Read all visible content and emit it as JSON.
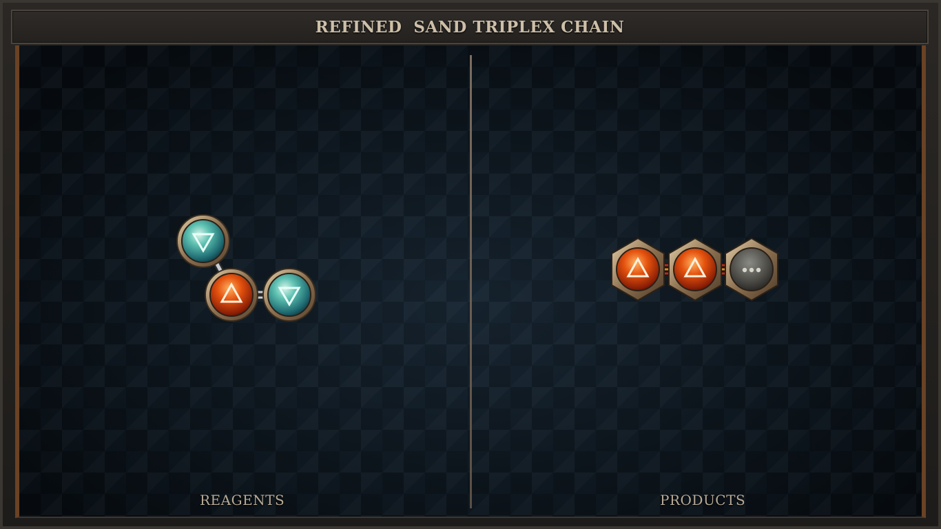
{
  "title": "REFINED  SAND TRIPLEX CHAIN",
  "reagents": {
    "label": "REAGENTS",
    "atoms": [
      {
        "element": "water",
        "symbol": "water-triangle-down-icon"
      },
      {
        "element": "fire",
        "symbol": "fire-triangle-up-icon"
      },
      {
        "element": "water",
        "symbol": "water-triangle-down-icon"
      }
    ]
  },
  "products": {
    "label": "PRODUCTS",
    "atoms": [
      {
        "element": "fire",
        "symbol": "fire-triangle-up-icon"
      },
      {
        "element": "fire",
        "symbol": "fire-triangle-up-icon"
      },
      {
        "element": "salt",
        "symbol": "salt-dots-icon"
      }
    ],
    "bond_type": "triplex"
  },
  "colors": {
    "water": "#43b0a8",
    "fire": "#d9480a",
    "salt": "#5a5954",
    "brass": "#b89a72",
    "bond_red": "#c0281c",
    "bond_orange": "#e08a1a"
  }
}
